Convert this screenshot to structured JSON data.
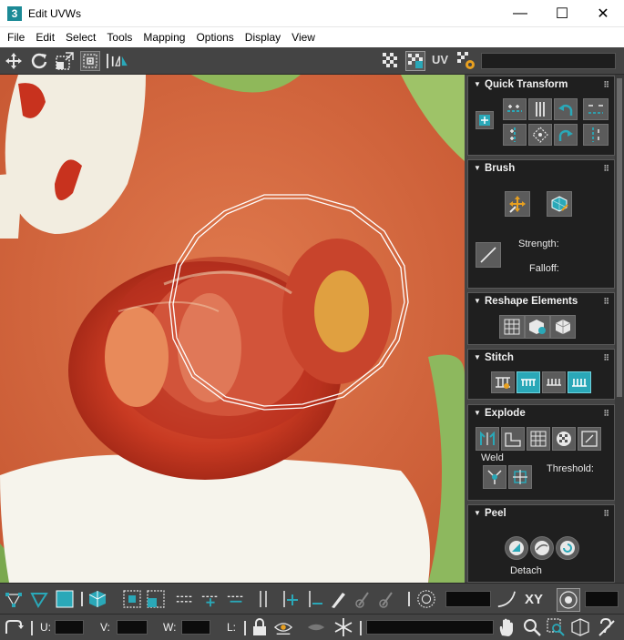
{
  "window": {
    "title": "Edit UVWs",
    "app_icon_glyph": "3",
    "minimize_glyph": "—",
    "maximize_glyph": "☐",
    "close_glyph": "✕"
  },
  "menu": [
    "File",
    "Edit",
    "Select",
    "Tools",
    "Mapping",
    "Options",
    "Display",
    "View"
  ],
  "toolbar_top": {
    "uv_label": "UV",
    "icons": [
      "move-icon",
      "rotate-icon",
      "scale-icon",
      "freeform-icon",
      "mirror-icon",
      "checker-icon",
      "show-map-icon",
      "uv-space-icon",
      "settings-icon"
    ]
  },
  "rollouts": {
    "quick_transform": {
      "title": "Quick Transform"
    },
    "brush": {
      "title": "Brush",
      "strength_label": "Strength:",
      "falloff_label": "Falloff:"
    },
    "reshape": {
      "title": "Reshape Elements"
    },
    "stitch": {
      "title": "Stitch"
    },
    "explode": {
      "title": "Explode",
      "weld_label": "Weld",
      "threshold_label": "Threshold:"
    },
    "peel": {
      "title": "Peel",
      "detach_label": "Detach"
    }
  },
  "statusbar": {
    "u_label": "U:",
    "v_label": "V:",
    "w_label": "W:",
    "l_label": "L:",
    "xy_label": "XY"
  },
  "colors": {
    "ui_dark": "#444444",
    "panel_bg": "#1f1f1f",
    "accent_teal": "#2aa8b8",
    "tomato_red": "#c8321e",
    "background_orange": "#d6643c",
    "uv_edge": "#ffffff"
  }
}
